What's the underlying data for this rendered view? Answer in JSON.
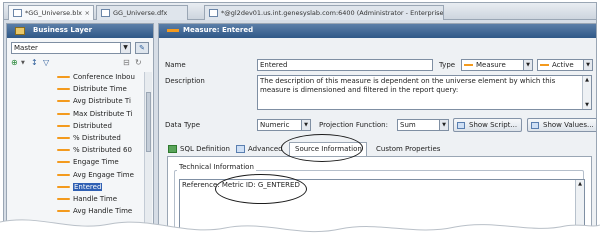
{
  "tabs": [
    {
      "label": "*GG_Universe.blx",
      "active": true
    },
    {
      "label": "GG_Universe.dfx",
      "active": false
    },
    {
      "label": "*@gl2dev01.us.int.genesyslab.com:6400 (Administrator - Enterprise)",
      "active": false
    }
  ],
  "left_panel": {
    "title": "Business Layer",
    "context_select": "Master",
    "tree_items": [
      {
        "label": "Conference Inbou",
        "selected": false
      },
      {
        "label": "Distribute Time",
        "selected": false
      },
      {
        "label": "Avg Distribute Ti",
        "selected": false
      },
      {
        "label": "Max Distribute Ti",
        "selected": false
      },
      {
        "label": "Distributed",
        "selected": false
      },
      {
        "label": "% Distributed",
        "selected": false
      },
      {
        "label": "% Distributed 60",
        "selected": false
      },
      {
        "label": "Engage Time",
        "selected": false
      },
      {
        "label": "Avg Engage Time",
        "selected": false
      },
      {
        "label": "Entered",
        "selected": true
      },
      {
        "label": "Handle Time",
        "selected": false
      },
      {
        "label": "Avg Handle Time",
        "selected": false
      }
    ]
  },
  "right_panel": {
    "title": "Measure: Entered",
    "name_label": "Name",
    "name_value": "Entered",
    "type_label": "Type",
    "type_value": "Measure",
    "state_value": "Active",
    "description_label": "Description",
    "description_text": "The description of this measure is dependent on the universe element by which this measure is dimensioned and filtered in the report query:",
    "data_type_label": "Data Type",
    "data_type_value": "Numeric",
    "projection_label": "Projection Function:",
    "projection_value": "Sum",
    "show_script_label": "Show Script...",
    "show_values_label": "Show Values...",
    "subtabs": [
      {
        "label": "SQL Definition",
        "active": false
      },
      {
        "label": "Advanced",
        "active": false
      },
      {
        "label": "Source Information",
        "active": true
      },
      {
        "label": "Custom Properties",
        "active": false
      }
    ],
    "group_title": "Technical Information",
    "tech_text_prefix": "Reference:",
    "tech_text_metric": "Metric ID: G_ENTERED"
  },
  "colors": {
    "header_blue": "#2f5887",
    "measure_orange": "#f39a1e",
    "selection_blue": "#2f5fb3"
  }
}
